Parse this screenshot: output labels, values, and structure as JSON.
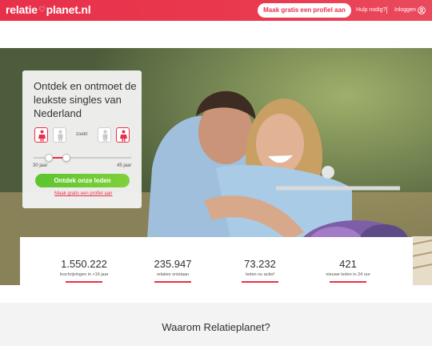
{
  "header": {
    "logo": {
      "part1": "relatie",
      "part2": "planet.nl"
    },
    "cta_label": "Maak gratis een profiel aan",
    "help_label": "Hulp nodig?",
    "login_label": "Inloggen"
  },
  "search": {
    "title": "Ontdek en ontmoet de leukste singles van Nederland",
    "seeking_label": "zoekt",
    "age_min_label": "30 jaar",
    "age_max_label": "45 jaar",
    "submit_label": "Ontdek onze leden",
    "register_link": "Maak gratis een profiel aan"
  },
  "stats": [
    {
      "value": "1.550.222",
      "label": "Inschrijvingen in >16 jaar"
    },
    {
      "value": "235.947",
      "label": "relaties ontstaan"
    },
    {
      "value": "73.232",
      "label": "leden nu actief"
    },
    {
      "value": "421",
      "label": "nieuwe leden in 24 uur"
    }
  ],
  "section": {
    "title": "Waarom Relatieplanet?"
  },
  "colors": {
    "brand": "#e8304a",
    "button_green": "#6ccb34"
  }
}
